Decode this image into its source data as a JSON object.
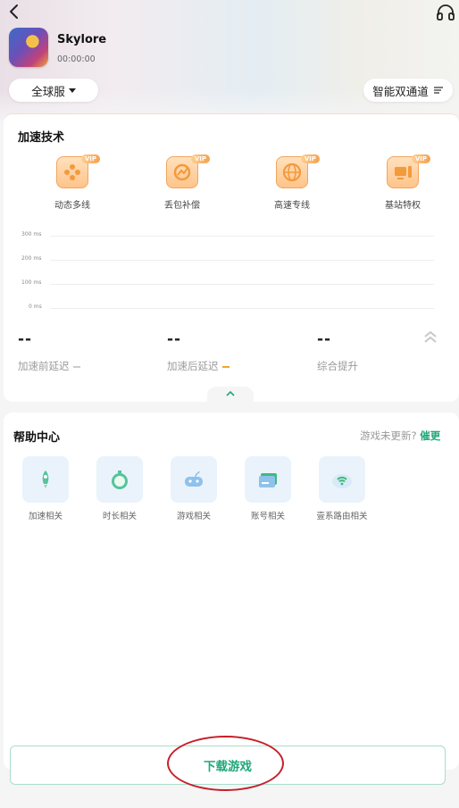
{
  "header": {
    "back_icon": "chevron-left-icon",
    "support_icon": "headset-icon",
    "game": {
      "name": "Skylore",
      "timer": "00:00:00"
    },
    "server_select": "全球服",
    "channel_select": "智能双通道",
    "channel_icon": "filter-lines-icon"
  },
  "acceleration": {
    "title": "加速技术",
    "features": [
      {
        "label": "动态多线",
        "icon": "gamepad-plus-icon",
        "badge": "VIP"
      },
      {
        "label": "丢包补偿",
        "icon": "packet-repair-icon",
        "badge": "VIP"
      },
      {
        "label": "高速专线",
        "icon": "globe-icon",
        "badge": "VIP"
      },
      {
        "label": "基站特权",
        "icon": "computer-tower-icon",
        "badge": "VIP"
      }
    ],
    "chart": {
      "ticks": [
        "300 ms",
        "200 ms",
        "100 ms",
        "0 ms"
      ]
    },
    "stats": [
      {
        "value": "--",
        "label": "加速前延迟",
        "color": "#cccccc"
      },
      {
        "value": "--",
        "label": "加速后延迟",
        "color": "#f5a623"
      },
      {
        "value": "--",
        "label": "综合提升"
      }
    ]
  },
  "help_center": {
    "title": "帮助中心",
    "update_prompt": "游戏未更新?",
    "update_link": "催更",
    "items": [
      {
        "label": "加速相关",
        "icon": "rocket-icon"
      },
      {
        "label": "时长相关",
        "icon": "stopwatch-icon"
      },
      {
        "label": "游戏相关",
        "icon": "gamepad-icon"
      },
      {
        "label": "账号相关",
        "icon": "card-icon"
      },
      {
        "label": "壹系路由相关",
        "icon": "router-wifi-icon"
      }
    ]
  },
  "download": {
    "label": "下载游戏"
  },
  "colors": {
    "accent_green": "#21a77a",
    "vip_orange": "#f5a04f",
    "annotation_red": "#c4202a"
  }
}
